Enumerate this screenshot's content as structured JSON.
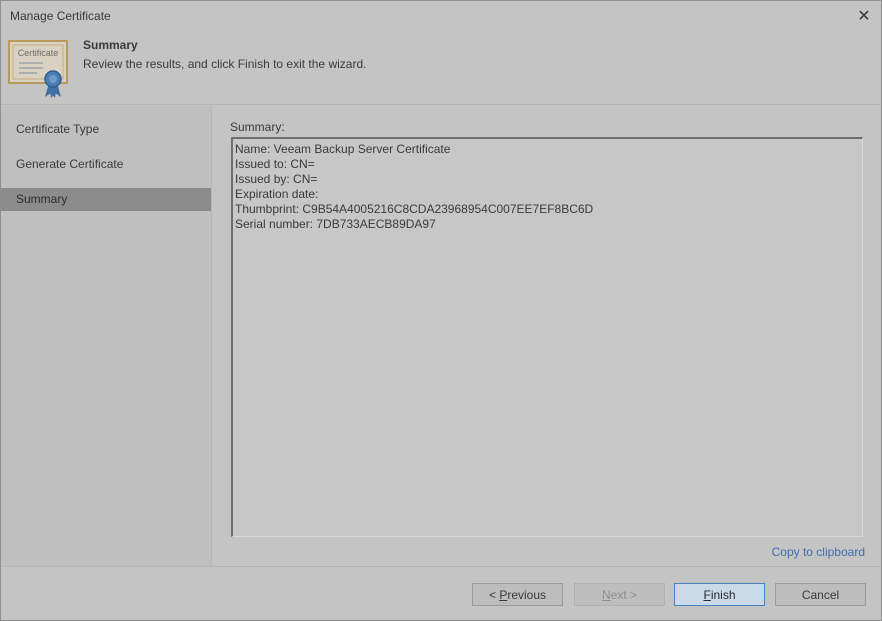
{
  "window": {
    "title": "Manage Certificate",
    "close_glyph": "✕"
  },
  "header": {
    "title": "Summary",
    "description": "Review the results, and click Finish to exit the wizard.",
    "icon_text": "Certificate",
    "icon": "certificate-icon"
  },
  "sidebar": {
    "items": [
      {
        "label": "Certificate Type",
        "selected": false
      },
      {
        "label": "Generate Certificate",
        "selected": false
      },
      {
        "label": "Summary",
        "selected": true
      }
    ]
  },
  "summary": {
    "label": "Summary:",
    "lines": [
      "Name: Veeam Backup Server Certificate",
      "Issued to: CN=",
      "Issued by: CN=",
      "Expiration date:",
      "Thumbprint: C9B54A4005216C8CDA23968954C007EE7EF8BC6D",
      "Serial number: 7DB733AECB89DA97"
    ],
    "copy_link": "Copy to clipboard"
  },
  "footer": {
    "previous": {
      "prefix": "< ",
      "mnemonic": "P",
      "rest": "revious"
    },
    "next": {
      "mnemonic": "N",
      "rest": "ext",
      "suffix": " >"
    },
    "finish": {
      "mnemonic": "F",
      "rest": "inish"
    },
    "cancel": "Cancel"
  },
  "colors": {
    "accent": "#4a83c4",
    "link": "#3f6fb0",
    "selected_nav": "#8c8c8c"
  }
}
